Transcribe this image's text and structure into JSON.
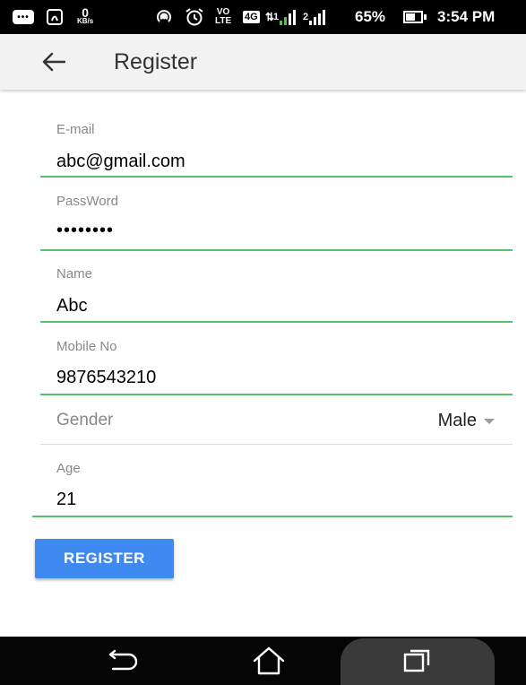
{
  "status_bar": {
    "message_icon": "message-icon",
    "nfc_icon": "nfc-icon",
    "speed_value": "0",
    "speed_unit": "KB/s",
    "hotspot_icon": "hotspot-icon",
    "alarm_icon": "alarm-icon",
    "volte_top": "VO",
    "volte_bottom": "LTE",
    "network_type": "4G",
    "sim1_label": "1",
    "sim2_label": "2",
    "battery_percent": "65%",
    "battery_level": 0.65,
    "time": "3:54 PM"
  },
  "app_bar": {
    "back_icon": "arrow-left-icon",
    "title": "Register"
  },
  "form": {
    "email": {
      "label": "E-mail",
      "value": "abc@gmail.com"
    },
    "password": {
      "label": "PassWord",
      "value": "••••••••"
    },
    "name": {
      "label": "Name",
      "value": "Abc"
    },
    "mobile": {
      "label": "Mobile No",
      "value": "9876543210"
    },
    "gender": {
      "label": "Gender",
      "value": "Male"
    },
    "age": {
      "label": "Age",
      "value": "21"
    },
    "accent_color": "#55c46d"
  },
  "register_button": {
    "label": "REGISTER",
    "color": "#3e8af0"
  },
  "nav_bar": {
    "back_icon": "nav-back-icon",
    "home_icon": "home-icon",
    "recent_icon": "recent-apps-icon"
  }
}
